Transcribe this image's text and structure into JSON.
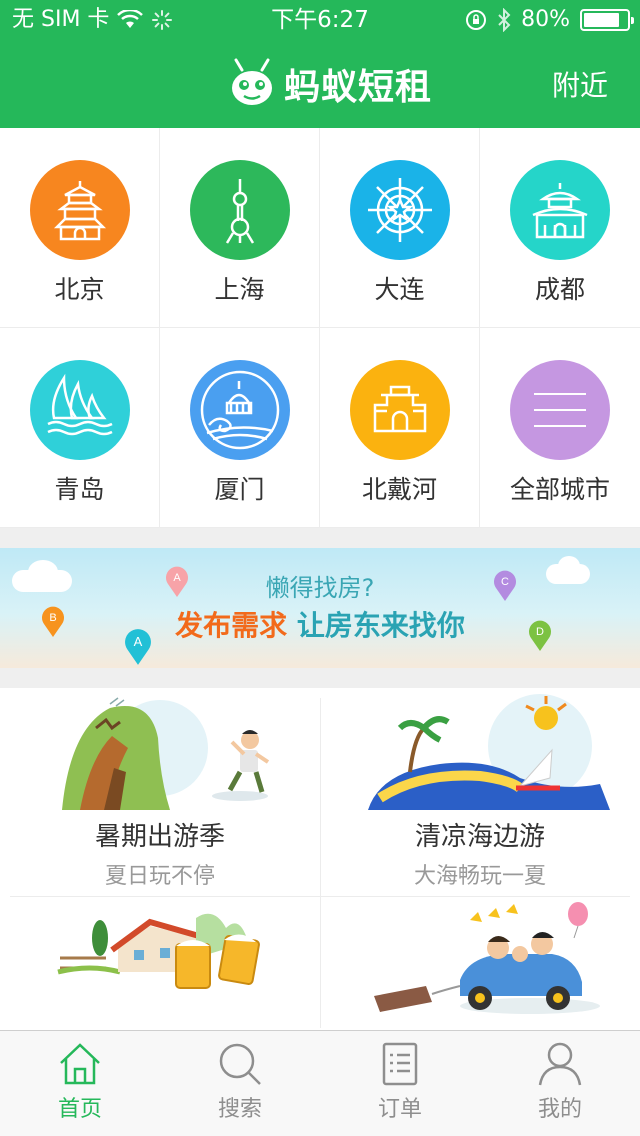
{
  "status_bar": {
    "carrier": "无 SIM 卡",
    "time": "下午6:27",
    "battery": "80%",
    "battery_level": 0.8
  },
  "header": {
    "app_name": "蚂蚁短租",
    "nearby_label": "附近",
    "color": "#25b85a"
  },
  "cities": [
    {
      "name": "北京",
      "color": "#f7861f",
      "icon": "temple-icon"
    },
    {
      "name": "上海",
      "color": "#2db85b",
      "icon": "tower-icon"
    },
    {
      "name": "大连",
      "color": "#1ab3e8",
      "icon": "ship-wheel-icon"
    },
    {
      "name": "成都",
      "color": "#25d5c9",
      "icon": "pavilion-icon"
    },
    {
      "name": "青岛",
      "color": "#2fd0d9",
      "icon": "sailboat-icon"
    },
    {
      "name": "厦门",
      "color": "#4a9ff0",
      "icon": "island-icon"
    },
    {
      "name": "北戴河",
      "color": "#fbb20f",
      "icon": "gate-icon"
    },
    {
      "name": "全部城市",
      "color": "#c597e1",
      "icon": "menu-icon"
    }
  ],
  "banner": {
    "line1": "懒得找房?",
    "line2_a": "发布需求",
    "line2_b": "让房东来找你",
    "pins": [
      "A",
      "B",
      "A",
      "C",
      "D"
    ]
  },
  "promos": [
    {
      "title": "暑期出游季",
      "subtitle": "夏日玩不停"
    },
    {
      "title": "清凉海边游",
      "subtitle": "大海畅玩一夏"
    },
    {
      "title": "",
      "subtitle": ""
    },
    {
      "title": "",
      "subtitle": ""
    }
  ],
  "tabs": [
    {
      "label": "首页",
      "icon": "home-icon",
      "active": true
    },
    {
      "label": "搜索",
      "icon": "search-icon",
      "active": false
    },
    {
      "label": "订单",
      "icon": "order-list-icon",
      "active": false
    },
    {
      "label": "我的",
      "icon": "profile-icon",
      "active": false
    }
  ]
}
